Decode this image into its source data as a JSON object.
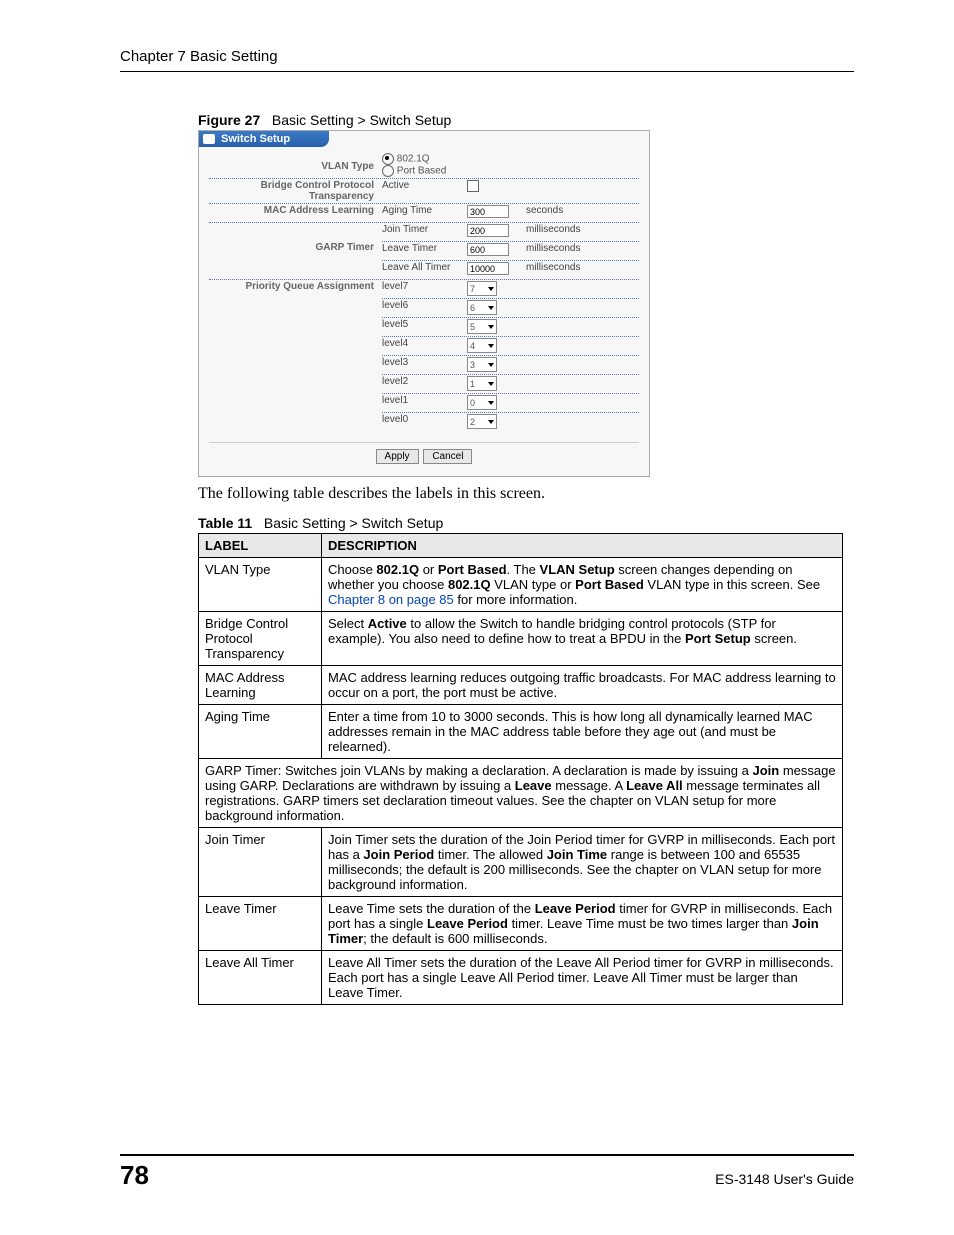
{
  "header": {
    "chapter": "Chapter 7 Basic Setting"
  },
  "figure": {
    "num": "Figure 27",
    "title": "Basic Setting > Switch Setup"
  },
  "screenshot": {
    "title": "Switch Setup",
    "vlan": {
      "label": "VLAN Type",
      "opt1": "802.1Q",
      "opt2": "Port Based",
      "selected": "opt1"
    },
    "bridge": {
      "label": "Bridge Control Protocol Transparency",
      "sub": "Active",
      "checked": false
    },
    "mac": {
      "label": "MAC Address Learning",
      "sub": "Aging Time",
      "value": "300",
      "unit": "seconds"
    },
    "garp": {
      "label": "GARP Timer",
      "rows": [
        {
          "sub": "Join Timer",
          "value": "200",
          "unit": "milliseconds"
        },
        {
          "sub": "Leave Timer",
          "value": "600",
          "unit": "milliseconds"
        },
        {
          "sub": "Leave All Timer",
          "value": "10000",
          "unit": "milliseconds"
        }
      ]
    },
    "priority": {
      "label": "Priority Queue Assignment",
      "rows": [
        {
          "sub": "level7",
          "value": "7"
        },
        {
          "sub": "level6",
          "value": "6"
        },
        {
          "sub": "level5",
          "value": "5"
        },
        {
          "sub": "level4",
          "value": "4"
        },
        {
          "sub": "level3",
          "value": "3"
        },
        {
          "sub": "level2",
          "value": "1"
        },
        {
          "sub": "level1",
          "value": "0"
        },
        {
          "sub": "level0",
          "value": "2"
        }
      ]
    },
    "buttons": {
      "apply": "Apply",
      "cancel": "Cancel"
    }
  },
  "intro_text": "The following table describes the labels in this screen.",
  "table_caption": {
    "num": "Table 11",
    "title": "Basic Setting > Switch Setup"
  },
  "table": {
    "head": {
      "label": "LABEL",
      "desc": "DESCRIPTION"
    },
    "rows": {
      "r0": {
        "label": "VLAN Type",
        "p1": "Choose ",
        "b1": "802.1Q",
        "p2": " or ",
        "b2": "Port Based",
        "p3": ". The ",
        "b3": "VLAN Setup",
        "p4": " screen changes depending on whether you choose ",
        "b4": "802.1Q",
        "p5": " VLAN type or ",
        "b5": "Port Based",
        "p6": " VLAN type in this screen. See ",
        "link": "Chapter 8 on page 85",
        "p7": " for more information."
      },
      "r1": {
        "label": "Bridge Control Protocol Transparency",
        "p1": "Select ",
        "b1": "Active",
        "p2": " to allow the Switch to handle bridging control protocols (STP for example). You also need to define how to treat a BPDU in the ",
        "b2": "Port Setup",
        "p3": " screen."
      },
      "r2": {
        "label": "MAC Address Learning",
        "desc": "MAC address learning reduces outgoing traffic broadcasts. For MAC address learning to occur on a port, the port must be active."
      },
      "r3": {
        "label": "Aging Time",
        "desc": "Enter a time from 10 to 3000 seconds. This is how long all dynamically learned MAC addresses remain in the MAC address table before they age out (and must be relearned)."
      },
      "r4": {
        "p1": "GARP Timer: Switches join VLANs by making a declaration. A declaration is made by issuing a ",
        "b1": "Join",
        "p2": " message using GARP. Declarations are withdrawn by issuing a ",
        "b2": "Leave",
        "p3": " message. A ",
        "b3": "Leave All",
        "p4": " message terminates all registrations. GARP timers set declaration timeout values. See the chapter on VLAN setup for more background information."
      },
      "r5": {
        "label": "Join Timer",
        "p1": "Join Timer sets the duration of the Join Period timer for GVRP in milliseconds. Each port has a ",
        "b1": "Join Period",
        "p2": " timer. The allowed ",
        "b2": "Join Time",
        "p3": " range is between 100 and 65535 milliseconds; the default is 200 milliseconds. See the chapter on VLAN setup for more background information."
      },
      "r6": {
        "label": "Leave Timer",
        "p1": "Leave Time sets the duration of the ",
        "b1": "Leave Period",
        "p2": " timer for GVRP in milliseconds. Each port has a single ",
        "b2": "Leave Period",
        "p3": " timer. Leave Time must be two times larger than ",
        "b3": "Join Timer",
        "p4": "; the default is 600 milliseconds."
      },
      "r7": {
        "label": "Leave All Timer",
        "desc": "Leave All Timer sets the duration of the Leave All Period timer for GVRP in milliseconds. Each port has a single Leave All Period timer. Leave All Timer must be larger than Leave Timer."
      }
    }
  },
  "footer": {
    "page": "78",
    "guide": "ES-3148 User's Guide"
  }
}
